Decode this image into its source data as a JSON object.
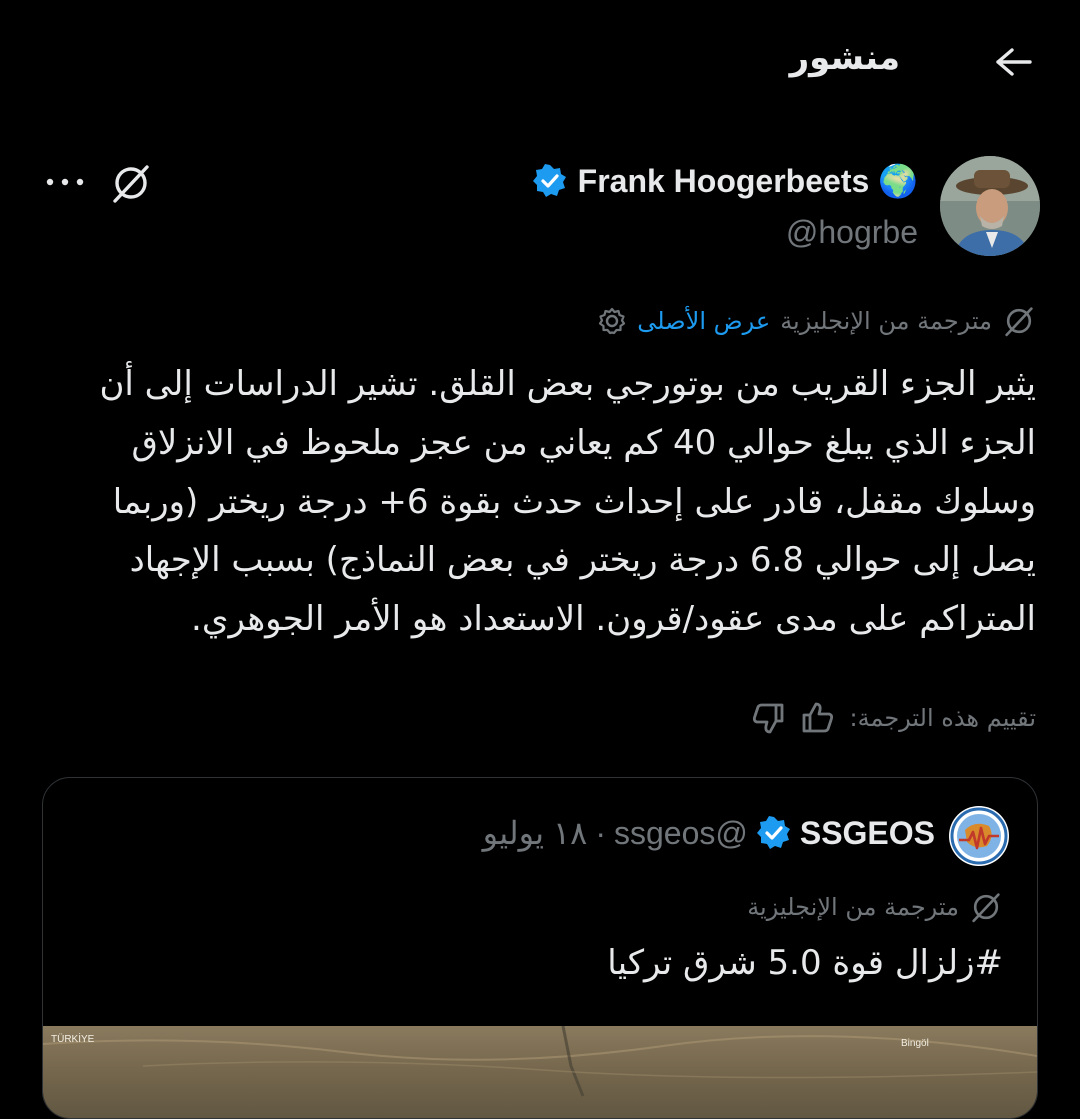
{
  "header": {
    "title": "منشور"
  },
  "icons": {
    "back": "arrow-right-icon",
    "grok": "grok-icon",
    "more": "more-horizontal-icon",
    "verified": "verified-badge-icon",
    "translate": "translate-icon",
    "settings": "gear-icon",
    "like": "thumbs-up-icon",
    "dislike": "thumbs-down-icon"
  },
  "post": {
    "author_name": "Frank Hoogerbeets 🌍",
    "handle": "@hogrbe",
    "translated_from": "مترجمة من الإنجليزية",
    "show_original": "عرض الأصلى",
    "text": "يثير الجزء القريب من بوتورجي بعض القلق. تشير الدراسات إلى أن الجزء الذي يبلغ حوالي 40 كم يعاني من عجز ملحوظ في الانزلاق وسلوك مقفل، قادر على إحداث حدث بقوة 6+ درجة ريختر (وربما يصل إلى حوالي 6.8 درجة ريختر في بعض النماذج) بسبب الإجهاد المتراكم على مدى عقود/قرون. الاستعداد هو الأمر الجوهري.",
    "rate_label": "تقييم هذه الترجمة:"
  },
  "quote": {
    "author_name": "SSGEOS",
    "handle": "@ssgeos",
    "separator": "·",
    "date": "١٨ يوليو",
    "translated_from": "مترجمة من الإنجليزية",
    "text": "#زلزال قوة 5.0 شرق تركيا",
    "map_labels": [
      "TÜRKİYE",
      "Bingöl"
    ]
  },
  "colors": {
    "background": "#000000",
    "text": "#e7e9ea",
    "muted": "#71767b",
    "accent": "#1d9bf0",
    "border": "#2f3336"
  }
}
